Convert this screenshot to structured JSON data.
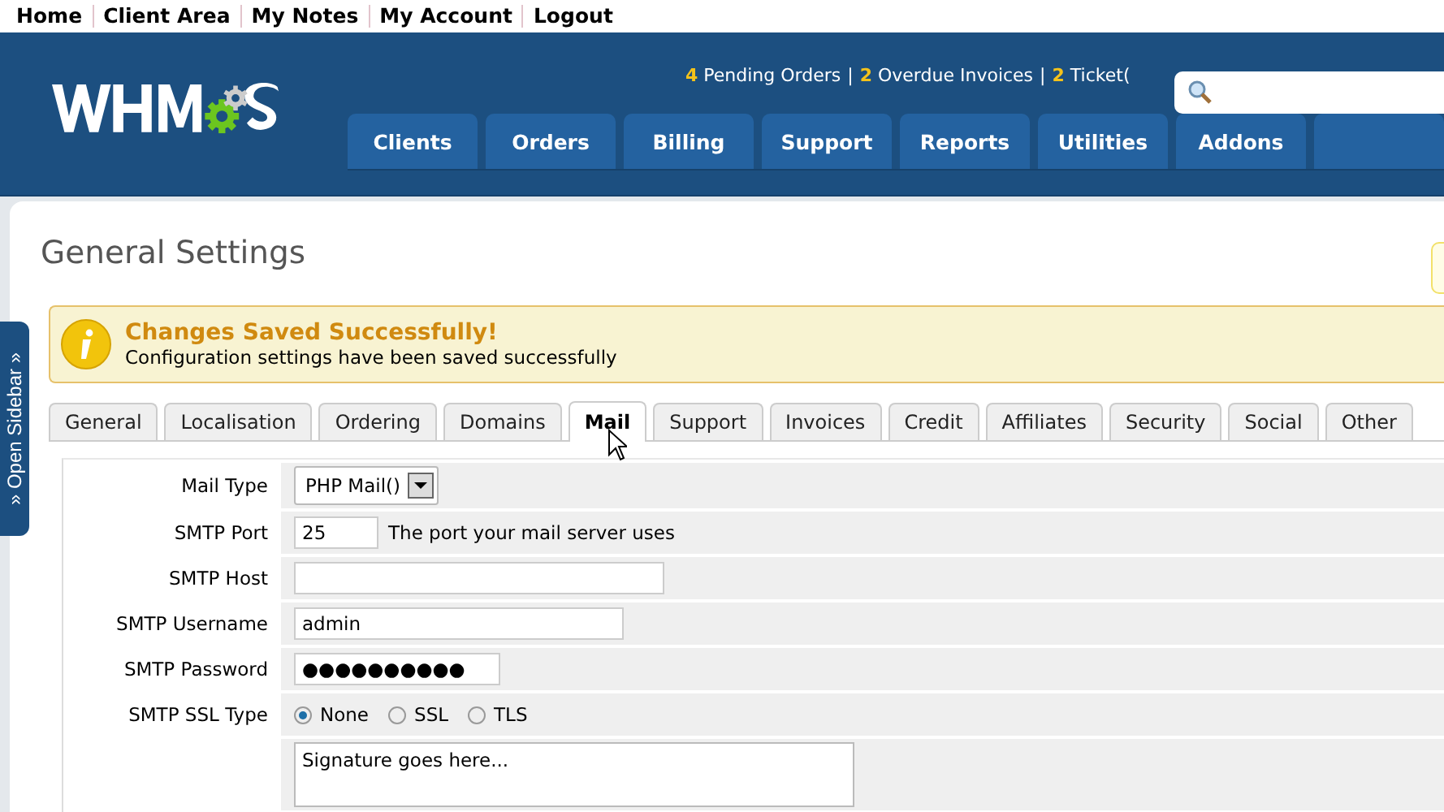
{
  "top_links": [
    "Home",
    "Client Area",
    "My Notes",
    "My Account",
    "Logout"
  ],
  "header": {
    "stats_separator": "|",
    "stats": [
      {
        "count": "4",
        "label": "Pending Orders"
      },
      {
        "count": "2",
        "label": "Overdue Invoices"
      },
      {
        "count": "2",
        "label": "Ticket("
      }
    ],
    "nav": [
      {
        "label": "Clients"
      },
      {
        "label": "Orders"
      },
      {
        "label": "Billing"
      },
      {
        "label": "Support"
      },
      {
        "label": "Reports"
      },
      {
        "label": "Utilities"
      },
      {
        "label": "Addons"
      }
    ]
  },
  "sidebar_toggle": {
    "label": "» Open Sidebar »"
  },
  "page": {
    "title": "General Settings"
  },
  "alert": {
    "title": "Changes Saved Successfully!",
    "message": "Configuration settings have been saved successfully"
  },
  "tabs": [
    {
      "label": "General",
      "selected": false
    },
    {
      "label": "Localisation",
      "selected": false
    },
    {
      "label": "Ordering",
      "selected": false
    },
    {
      "label": "Domains",
      "selected": false
    },
    {
      "label": "Mail",
      "selected": true
    },
    {
      "label": "Support",
      "selected": false
    },
    {
      "label": "Invoices",
      "selected": false
    },
    {
      "label": "Credit",
      "selected": false
    },
    {
      "label": "Affiliates",
      "selected": false
    },
    {
      "label": "Security",
      "selected": false
    },
    {
      "label": "Social",
      "selected": false
    },
    {
      "label": "Other",
      "selected": false
    }
  ],
  "form": [
    {
      "kind": "select",
      "label": "Mail Type",
      "value": "PHP Mail()"
    },
    {
      "kind": "text",
      "label": "SMTP Port",
      "value": "25",
      "hint": "The port your mail server uses"
    },
    {
      "kind": "text",
      "label": "SMTP Host"
    },
    {
      "kind": "text",
      "label": "SMTP Username",
      "value": "admin"
    },
    {
      "kind": "text",
      "label": "SMTP Password",
      "value": "●●●●●●●●●●"
    },
    {
      "kind": "radio",
      "label": "SMTP SSL Type",
      "options": [
        {
          "label": "None",
          "selected": true
        },
        {
          "label": "SSL",
          "selected": false
        },
        {
          "label": "TLS",
          "selected": false
        }
      ]
    },
    {
      "kind": "textarea",
      "placeholder": "Signature goes here..."
    }
  ]
}
